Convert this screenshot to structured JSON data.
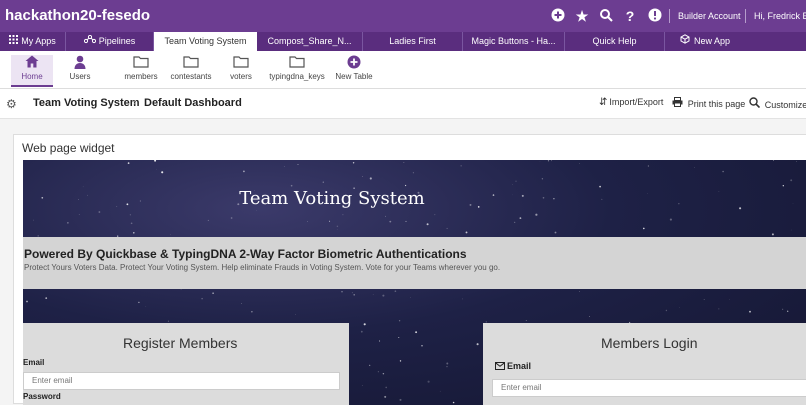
{
  "app_title": "hackathon20-fesedo",
  "topbar": {
    "builder_account": "Builder Account",
    "greeting": "Hi, Fredrick Es"
  },
  "tabs": [
    {
      "label": "My Apps"
    },
    {
      "label": "Pipelines"
    },
    {
      "label": "Team Voting System"
    },
    {
      "label": "Compost_Share_N..."
    },
    {
      "label": "Ladies First"
    },
    {
      "label": "Magic Buttons - Ha..."
    },
    {
      "label": "Quick Help"
    },
    {
      "label": "New App"
    }
  ],
  "tables": [
    {
      "label": "Home"
    },
    {
      "label": "Users"
    },
    {
      "label": "members"
    },
    {
      "label": "contestants"
    },
    {
      "label": "voters"
    },
    {
      "label": "typingdna_keys"
    },
    {
      "label": "New Table"
    }
  ],
  "dashboard": {
    "app_name": "Team Voting System",
    "name": "Default Dashboard",
    "import_export": "Import/Export",
    "print": "Print this page",
    "customize": "Customize th"
  },
  "widget": {
    "title": "Web page widget",
    "hero_title": "Team Voting System",
    "band_heading": "Powered By Quickbase & TypingDNA 2-Way Factor Biometric Authentications",
    "band_text": "Protect Yours Voters Data. Protect Your Voting System. Help eliminate Frauds in Voting System. Vote for your Teams wherever you go.",
    "register": {
      "title": "Register Members",
      "email_label": "Email",
      "email_placeholder": "Enter email",
      "password_label": "Password"
    },
    "login": {
      "title": "Members Login",
      "email_label": "Email",
      "email_placeholder": "Enter email"
    }
  },
  "colors": {
    "brand_purple": "#6c3d91",
    "tab_purple": "#5a2d7e"
  }
}
